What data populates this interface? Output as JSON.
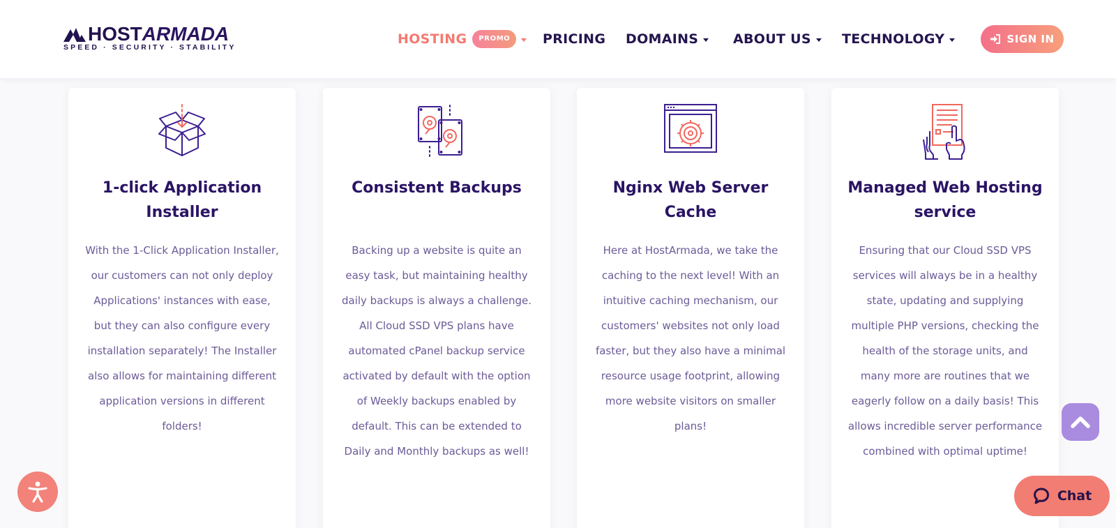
{
  "colors": {
    "brand_dark": "#22124f",
    "accent_coral": "#f37a72",
    "promo_gradient": [
      "#f7829a",
      "#f29b7c"
    ],
    "signin_gradient": [
      "#f4708a",
      "#f6a07c"
    ],
    "title_purple": "#2a1464",
    "body_text": "#6c5b98",
    "scroll_top_bg": "#a98be0",
    "chat_bg": "#f27d72",
    "page_bg": "#f9f9fb"
  },
  "header": {
    "logo": {
      "word_host": "HOST",
      "word_armada": "ARMADA",
      "tagline": "SPEED · SECURITY · STABILITY",
      "icon": "ship-sails-icon"
    },
    "nav": [
      {
        "label": "HOSTING",
        "badge": "PROMO",
        "dropdown": true,
        "active": true
      },
      {
        "label": "PRICING",
        "dropdown": false,
        "active": false
      },
      {
        "label": "DOMAINS",
        "dropdown": true,
        "active": false
      },
      {
        "label": "ABOUT US",
        "dropdown": true,
        "active": false
      },
      {
        "label": "TECHNOLOGY",
        "dropdown": true,
        "active": false
      }
    ],
    "signin": {
      "label": "SIGN IN",
      "icon": "sign-in-icon"
    }
  },
  "features": [
    {
      "icon": "box-download-icon",
      "title": "1-click Application Installer",
      "description": "With the 1-Click Application Installer, our customers can not only deploy Applications' instances with ease, but they can also configure every installation separately! The Installer also allows for maintaining different application versions in different folders!"
    },
    {
      "icon": "hard-drives-icon",
      "title": "Consistent Backups",
      "description": "Backing up a website is quite an easy task, but maintaining healthy daily backups is always a challenge. All Cloud SSD VPS plans have automated cPanel backup service activated by default with the option of Weekly backups enabled by default. This can be extended to Daily and Monthly backups as well!"
    },
    {
      "icon": "server-gear-icon",
      "title": "Nginx Web Server Cache",
      "description": "Here at HostArmada, we take the caching to the next level! With an intuitive caching mechanism, our customers' websites not only load faster, but they also have a minimal resource usage footprint, allowing more website visitors on smaller plans!"
    },
    {
      "icon": "managed-hands-icon",
      "title": "Managed Web Hosting service",
      "description": "Ensuring that our Cloud SSD VPS services will always be in a healthy state, updating and supplying multiple PHP versions, checking the health of the storage units, and many more are routines that we eagerly follow on a daily basis! This allows incredible server performance combined with optimal uptime!"
    }
  ],
  "widgets": {
    "accessibility": {
      "icon": "accessibility-person-icon"
    },
    "scroll_top": {
      "icon": "chevron-up-icon"
    },
    "chat": {
      "label": "Chat",
      "icon": "chat-bubble-icon"
    }
  }
}
